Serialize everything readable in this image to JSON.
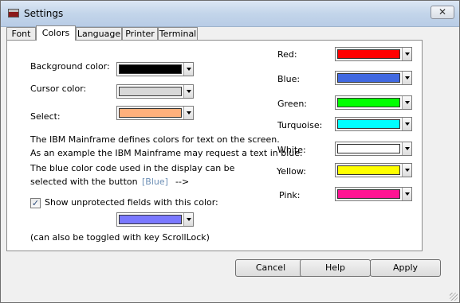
{
  "window": {
    "title": "Settings",
    "close_symbol": "✕"
  },
  "tabs": [
    "Font",
    "Colors",
    "Language",
    "Printer",
    "Terminal"
  ],
  "left": {
    "background": {
      "label": "Background color:",
      "color": "#000000"
    },
    "cursor": {
      "label": "Cursor color:",
      "color": "#d8d8d8"
    },
    "select": {
      "label": "Select:",
      "color": "#ffb07c"
    },
    "info_lines": [
      "The IBM Mainframe defines colors for text on the screen.",
      "As an example the IBM Mainframe may request a text in blue.",
      "The blue color code used in the display can be",
      "selected with the button"
    ],
    "blue_hint": "[Blue]",
    "arrow_hint": "-->",
    "unprotected": {
      "label": "Show unprotected fields with this color:",
      "checked": true,
      "check_symbol": "✓",
      "color": "#7a78ff"
    },
    "toggle_note": "(can also be toggled with key ScrollLock)"
  },
  "right": {
    "colors": [
      {
        "label": "Red:",
        "color": "#ff0000"
      },
      {
        "label": "Blue:",
        "color": "#4169e1"
      },
      {
        "label": "Green:",
        "color": "#00ff00"
      },
      {
        "label": "Turquoise:",
        "color": "#00ffff"
      },
      {
        "label": "White:",
        "color": "#ffffff"
      },
      {
        "label": "Yellow:",
        "color": "#ffff00"
      },
      {
        "label": "Pink:",
        "color": "#ff1493"
      }
    ]
  },
  "buttons": {
    "cancel": "Cancel",
    "help": "Help",
    "apply": "Apply"
  }
}
